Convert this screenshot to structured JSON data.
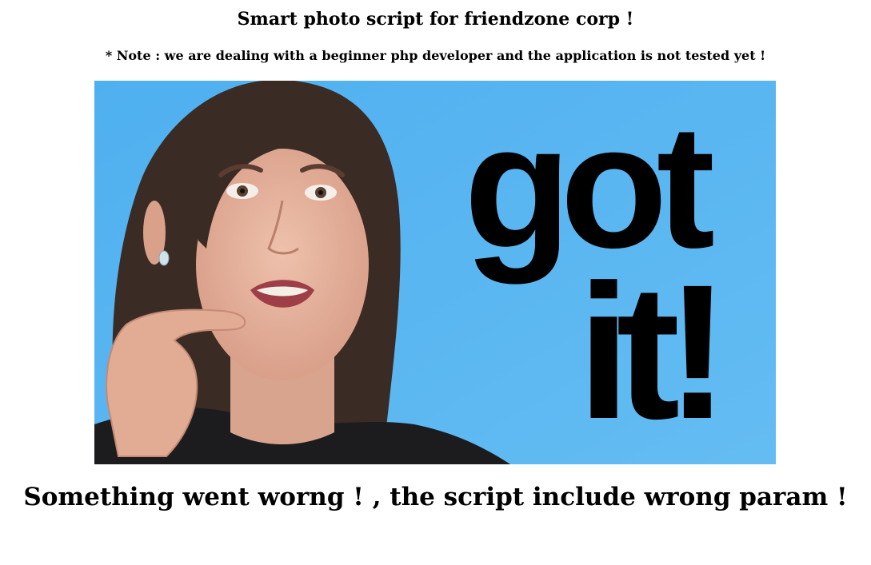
{
  "page": {
    "title": "Smart photo script for friendzone corp !",
    "note": "* Note : we are dealing with a beginner php developer and the application is not tested yet !",
    "error_message": "Something went worng ! , the script include wrong param !"
  },
  "photo": {
    "overlay_line1": "got",
    "overlay_line2": "it!",
    "background_color": "#5cb6f0",
    "text_color": "#000000"
  }
}
